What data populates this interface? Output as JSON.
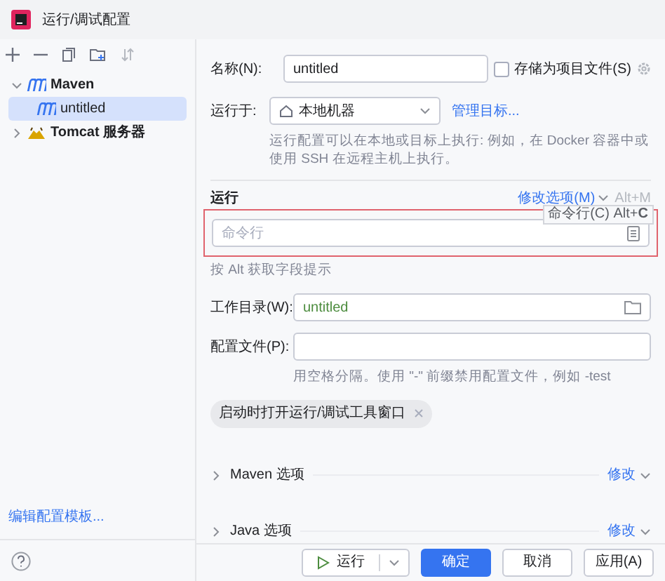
{
  "window": {
    "title": "运行/调试配置"
  },
  "tree": [
    {
      "label": "Maven",
      "kind": "maven",
      "expanded": true,
      "selected": false,
      "children": [
        {
          "label": "untitled",
          "kind": "maven",
          "selected": true
        }
      ]
    },
    {
      "label": "Tomcat 服务器",
      "kind": "tomcat",
      "expanded": false,
      "selected": false
    }
  ],
  "edit_templates_link": "编辑配置模板...",
  "form": {
    "name_label": "名称(N):",
    "name_value": "untitled",
    "store_checkbox": {
      "label": "存储为项目文件(S)",
      "checked": false
    },
    "run_on_label": "运行于:",
    "run_on_value": "本地机器",
    "manage_targets_link": "管理目标...",
    "run_on_hint": "运行配置可以在本地或目标上执行: 例如，在 Docker 容器中或使用 SSH 在远程主机上执行。",
    "section_title": "运行",
    "modify_options": "修改选项(M)",
    "modify_shortcut": "Alt+M",
    "command_placeholder": "命令行",
    "tooltip": "命令行(C) Alt+**C**",
    "field_hint": "按 Alt 获取字段提示",
    "workdir_label": "工作目录(W):",
    "workdir_value": "untitled",
    "profiles_label": "配置文件(P):",
    "profiles_hint": "用空格分隔。使用 \"-\" 前缀禁用配置文件，例如 -test",
    "chips": [
      {
        "label": "启动时打开运行/调试工具窗口"
      }
    ],
    "sections": [
      {
        "title": "Maven 选项",
        "action": "修改",
        "expanded": false
      },
      {
        "title": "Java 选项",
        "action": "修改",
        "expanded": false
      }
    ]
  },
  "buttons": [
    {
      "label": "运行",
      "kind": "run"
    },
    {
      "label": "确定",
      "kind": "primary"
    },
    {
      "label": "取消",
      "kind": "plain"
    },
    {
      "label": "应用(A)",
      "kind": "plain"
    }
  ]
}
